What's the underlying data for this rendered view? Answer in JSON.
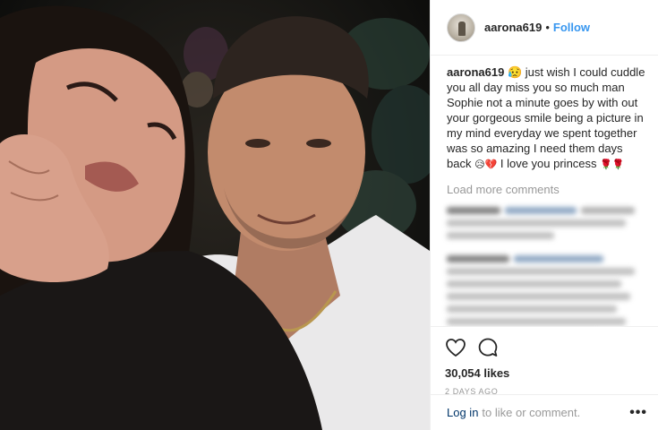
{
  "post": {
    "username": "aarona619",
    "follow_label": "Follow",
    "separator": "•",
    "caption": {
      "username": "aarona619",
      "text_part1": " 😥 just wish I could cuddle you all day miss you so much man Sophie not a minute goes by with out your gorgeous smile being a picture in my mind everyday we spent together was so amazing I need them days back ",
      "emoji_mid": "😥💔",
      "text_part2": " I love you princess ",
      "emoji_end": "🌹🌹"
    },
    "load_more_label": "Load more comments",
    "likes": "30,054 likes",
    "timestamp": "2 DAYS AGO",
    "login_link": "Log in",
    "login_text": "to like or comment.",
    "more_options": "•••",
    "icons": {
      "like": "heart-icon",
      "comment": "comment-bubble-icon",
      "more": "more-options-icon"
    },
    "colors": {
      "link_blue": "#3897f0",
      "dark_link": "#003569",
      "muted": "#999999",
      "text": "#262626"
    }
  }
}
